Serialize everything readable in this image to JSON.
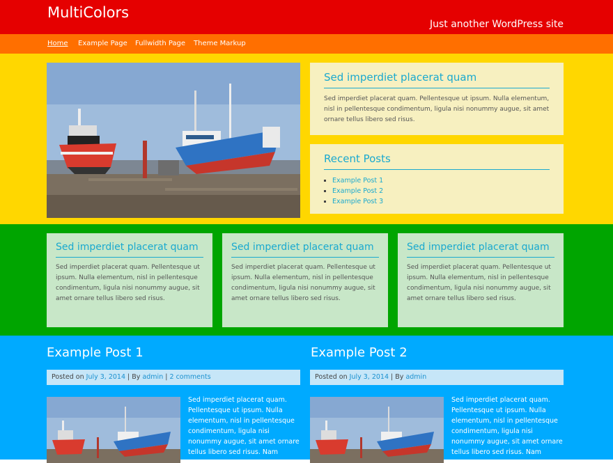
{
  "header": {
    "site_title": "MultiColors",
    "tagline": "Just another WordPress site"
  },
  "nav": {
    "items": [
      {
        "label": "Home",
        "active": true
      },
      {
        "label": "Example Page"
      },
      {
        "label": "Fullwidth Page"
      },
      {
        "label": "Theme Markup"
      }
    ]
  },
  "hero": {
    "image_alt": "Fishing boats in a shipyard"
  },
  "sidebar": {
    "text_widget": {
      "title": "Sed imperdiet placerat quam",
      "text": "Sed imperdiet placerat quam. Pellentesque ut ipsum. Nulla elementum, nisl in pellentesque condimentum, ligula nisi nonummy augue, sit amet ornare tellus libero sed risus."
    },
    "recent_posts": {
      "title": "Recent Posts",
      "items": [
        "Example Post 1",
        "Example Post 2",
        "Example Post 3"
      ]
    }
  },
  "footer_widgets": [
    {
      "title": "Sed imperdiet placerat quam",
      "text": "Sed imperdiet placerat quam. Pellentesque ut ipsum. Nulla elementum, nisl in pellentesque condimentum, ligula nisi nonummy augue, sit amet ornare tellus libero sed risus."
    },
    {
      "title": "Sed imperdiet placerat quam",
      "text": "Sed imperdiet placerat quam. Pellentesque ut ipsum. Nulla elementum, nisl in pellentesque condimentum, ligula nisi nonummy augue, sit amet ornare tellus libero sed risus."
    },
    {
      "title": "Sed imperdiet placerat quam",
      "text": "Sed imperdiet placerat quam. Pellentesque ut ipsum. Nulla elementum, nisl in pellentesque condimentum, ligula nisi nonummy augue, sit amet ornare tellus libero sed risus."
    }
  ],
  "posts": [
    {
      "title": "Example Post 1",
      "posted_on": "Posted on",
      "date": "July 3, 2014",
      "by": "By",
      "author": "admin",
      "comments": "2 comments",
      "excerpt": "Sed imperdiet placerat quam. Pellentesque ut ipsum. Nulla elementum, nisl in pellentesque condimentum, ligula nisi nonummy augue, sit amet ornare tellus libero sed risus. Nam"
    },
    {
      "title": "Example Post 2",
      "posted_on": "Posted on",
      "date": "July 3, 2014",
      "by": "By",
      "author": "admin",
      "excerpt": "Sed imperdiet placerat quam. Pellentesque ut ipsum. Nulla elementum, nisl in pellentesque condimentum, ligula nisi nonummy augue, sit amet ornare tellus libero sed risus. Nam"
    }
  ],
  "colors": {
    "red": "#e50000",
    "orange": "#ff6f00",
    "yellow": "#ffd700",
    "green": "#00a500",
    "blue": "#00aaff",
    "link": "#1aa9cf"
  }
}
